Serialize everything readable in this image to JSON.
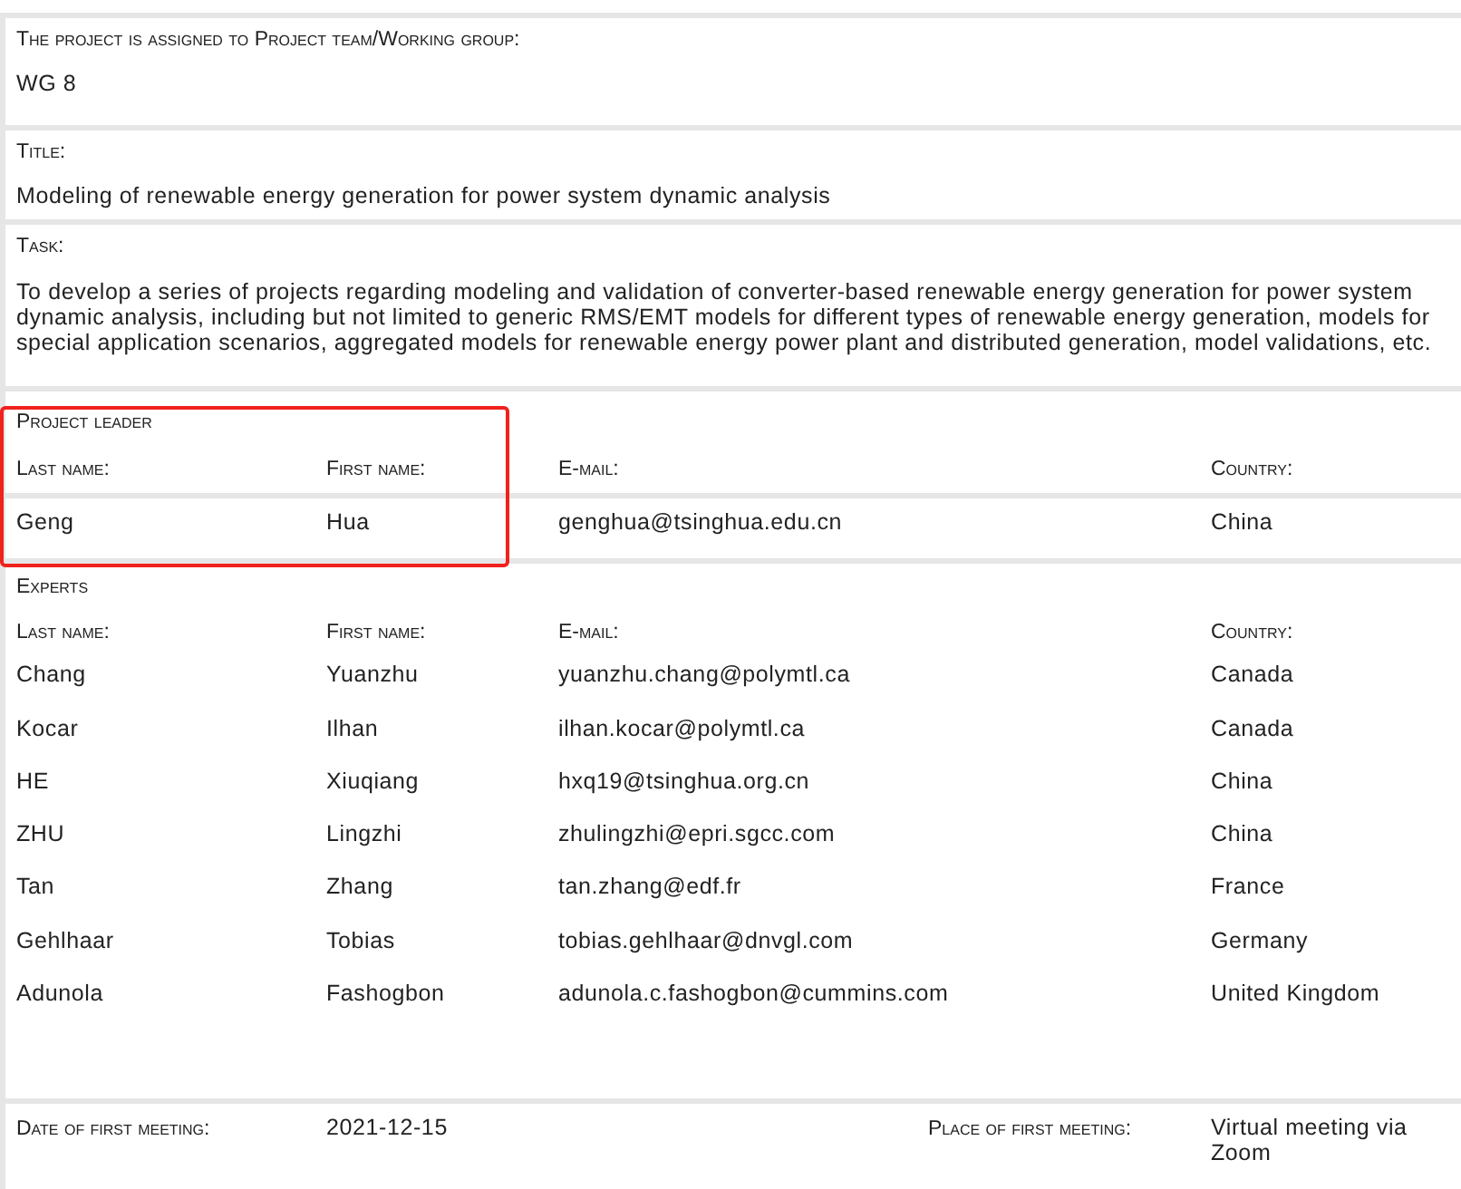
{
  "assignment": {
    "label": "The project is assigned to Project team/Working group:",
    "value": "WG 8"
  },
  "title": {
    "label": "Title:",
    "value": "Modeling of renewable energy generation for power system dynamic analysis"
  },
  "task": {
    "label": "Task:",
    "value": "To develop a series of projects regarding modeling and validation of converter-based renewable energy generation for power system dynamic analysis, including but not limited to generic RMS/EMT models for different types of renewable energy generation, models for special application scenarios, aggregated models for renewable energy power plant and distributed generation, model validations, etc."
  },
  "project_leader": {
    "heading": "Project leader",
    "highlighted": true,
    "columns": [
      "Last name:",
      "First name:",
      "E-mail:",
      "Country:"
    ],
    "rows": [
      [
        "Geng",
        "Hua",
        "genghua@tsinghua.edu.cn",
        "China"
      ]
    ]
  },
  "experts": {
    "heading": "Experts",
    "columns": [
      "Last name:",
      "First name:",
      "E-mail:",
      "Country:"
    ],
    "rows": [
      [
        "Chang",
        "Yuanzhu",
        "yuanzhu.chang@polymtl.ca",
        "Canada"
      ],
      [
        "Kocar",
        "Ilhan",
        "ilhan.kocar@polymtl.ca",
        "Canada"
      ],
      [
        "HE",
        "Xiuqiang",
        "hxq19@tsinghua.org.cn",
        "China"
      ],
      [
        "ZHU",
        "Lingzhi",
        "zhulingzhi@epri.sgcc.com",
        "China"
      ],
      [
        "Tan",
        "Zhang",
        "tan.zhang@edf.fr",
        "France"
      ],
      [
        "Gehlhaar",
        "Tobias",
        "tobias.gehlhaar@dnvgl.com",
        "Germany"
      ],
      [
        "Adunola",
        "Fashogbon",
        "adunola.c.fashogbon@cummins.com",
        "United Kingdom"
      ]
    ]
  },
  "meeting": {
    "date_label": "Date of first meeting:",
    "date": "2021-12-15",
    "place_label": "Place of first meeting:",
    "place": "Virtual meeting via Zoom"
  }
}
